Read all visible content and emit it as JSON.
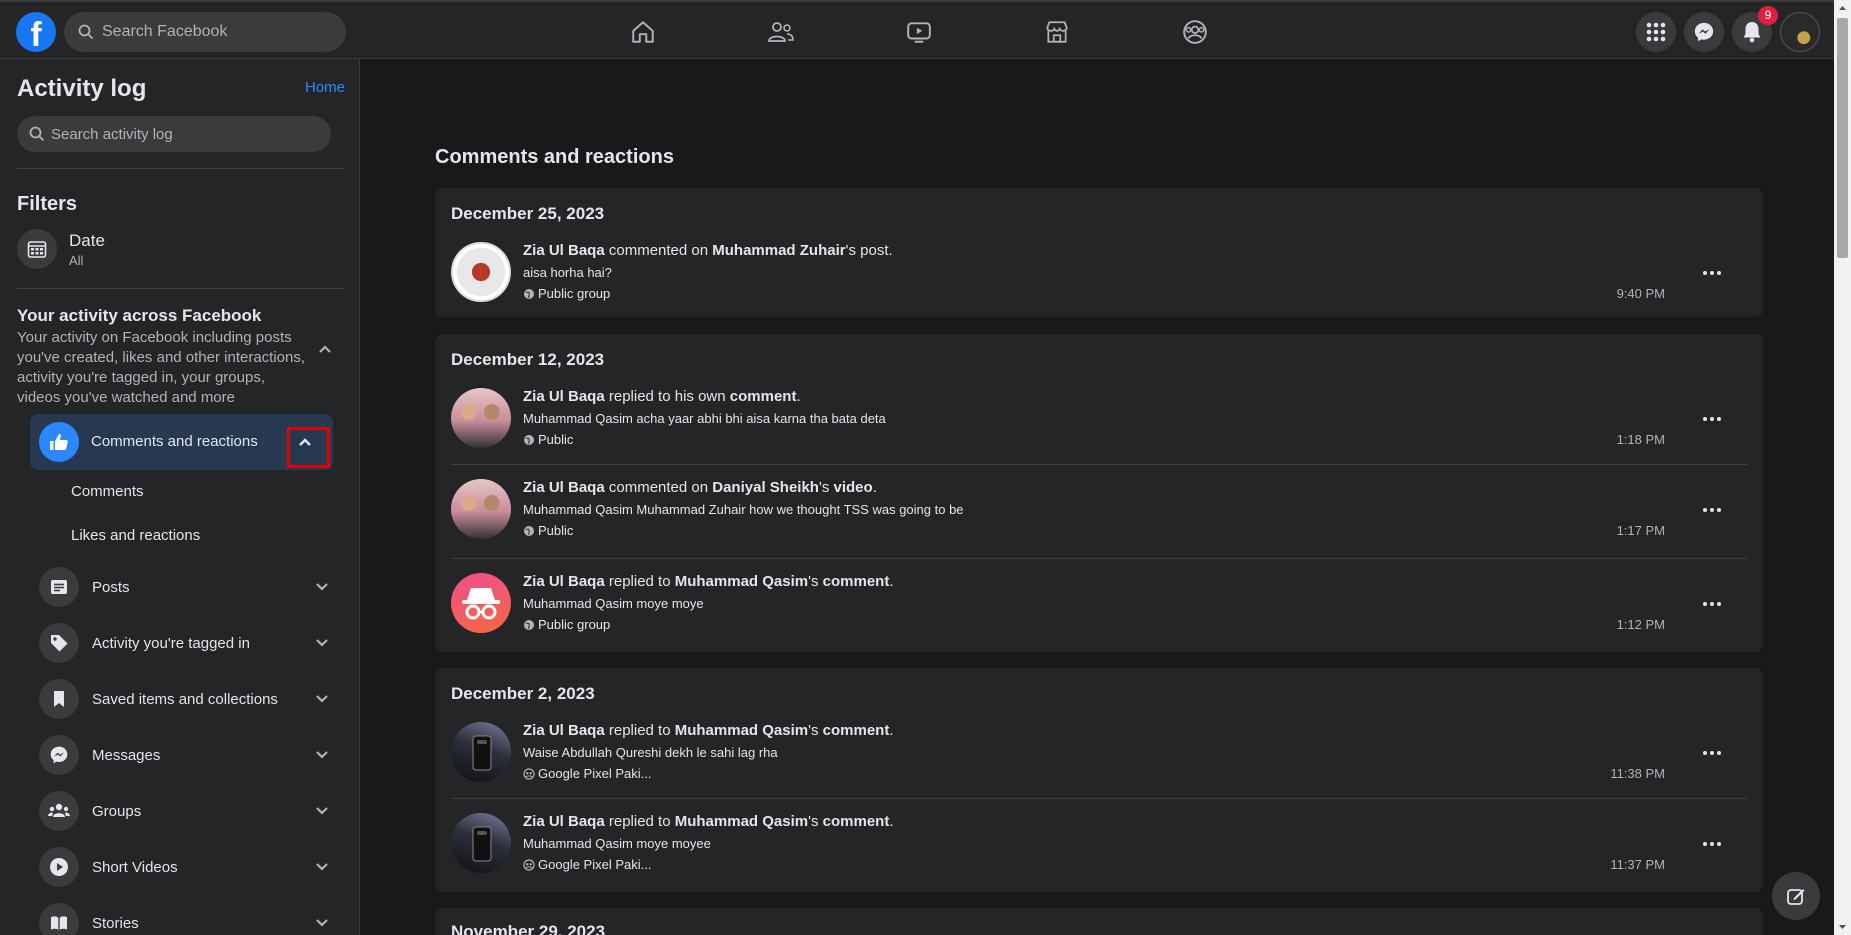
{
  "topbar": {
    "search_placeholder": "Search Facebook",
    "notification_count": "9",
    "nav": [
      "home-icon",
      "friends-icon",
      "watch-icon",
      "marketplace-icon",
      "groups-icon"
    ]
  },
  "sidebar": {
    "title": "Activity log",
    "home_link": "Home",
    "search_placeholder": "Search activity log",
    "filters_heading": "Filters",
    "date_label": "Date",
    "date_value": "All",
    "activity_heading": "Your activity across Facebook",
    "activity_desc": "Your activity on Facebook including posts you've created, likes and other interactions, activity you're tagged in, your groups, videos you've watched and more",
    "active_item": "Comments and reactions",
    "sub_items": [
      "Comments",
      "Likes and reactions"
    ],
    "items": [
      "Posts",
      "Activity you're tagged in",
      "Saved items and collections",
      "Messages",
      "Groups",
      "Short Videos",
      "Stories"
    ]
  },
  "main": {
    "section_title": "Comments and reactions",
    "groups": [
      {
        "date": "December 25, 2023",
        "entries": [
          {
            "actor": "Zia Ul Baqa",
            "verb": " commented on ",
            "target": "Muhammad Zuhair",
            "suffix": "'s post.",
            "object": "",
            "end": "",
            "text": "aisa horha hai?",
            "audience": "Public group",
            "time": "9:40 PM"
          }
        ]
      },
      {
        "date": "December 12, 2023",
        "entries": [
          {
            "actor": "Zia Ul Baqa",
            "verb": " replied to his own ",
            "target": "",
            "suffix": "",
            "object": "comment",
            "end": ".",
            "text": "Muhammad Qasim acha yaar abhi bhi aisa karna tha bata deta",
            "audience": "Public",
            "time": "1:18 PM"
          },
          {
            "actor": "Zia Ul Baqa",
            "verb": " commented on ",
            "target": "Daniyal Sheikh",
            "suffix": "'s ",
            "object": "video",
            "end": ".",
            "text": "Muhammad Qasim Muhammad Zuhair how we thought TSS was going to be",
            "audience": "Public",
            "time": "1:17 PM"
          },
          {
            "actor": "Zia Ul Baqa",
            "verb": " replied to ",
            "target": "Muhammad Qasim",
            "suffix": "'s ",
            "object": "comment",
            "end": ".",
            "text": "Muhammad Qasim moye moye",
            "audience": "Public group",
            "time": "1:12 PM"
          }
        ]
      },
      {
        "date": "December 2, 2023",
        "entries": [
          {
            "actor": "Zia Ul Baqa",
            "verb": " replied to ",
            "target": "Muhammad Qasim",
            "suffix": "'s ",
            "object": "comment",
            "end": ".",
            "text": "Waise Abdullah Qureshi dekh le sahi lag rha",
            "audience": "Google Pixel Paki...",
            "time": "11:38 PM"
          },
          {
            "actor": "Zia Ul Baqa",
            "verb": " replied to ",
            "target": "Muhammad Qasim",
            "suffix": "'s ",
            "object": "comment",
            "end": ".",
            "text": "Muhammad Qasim moye moyee",
            "audience": "Google Pixel Paki...",
            "time": "11:37 PM"
          }
        ]
      },
      {
        "date": "November 29, 2023",
        "entries": []
      }
    ]
  },
  "colors": {
    "accent": "#2d88ff",
    "badge": "#e41e3f",
    "highlight_box": "#e00000"
  }
}
